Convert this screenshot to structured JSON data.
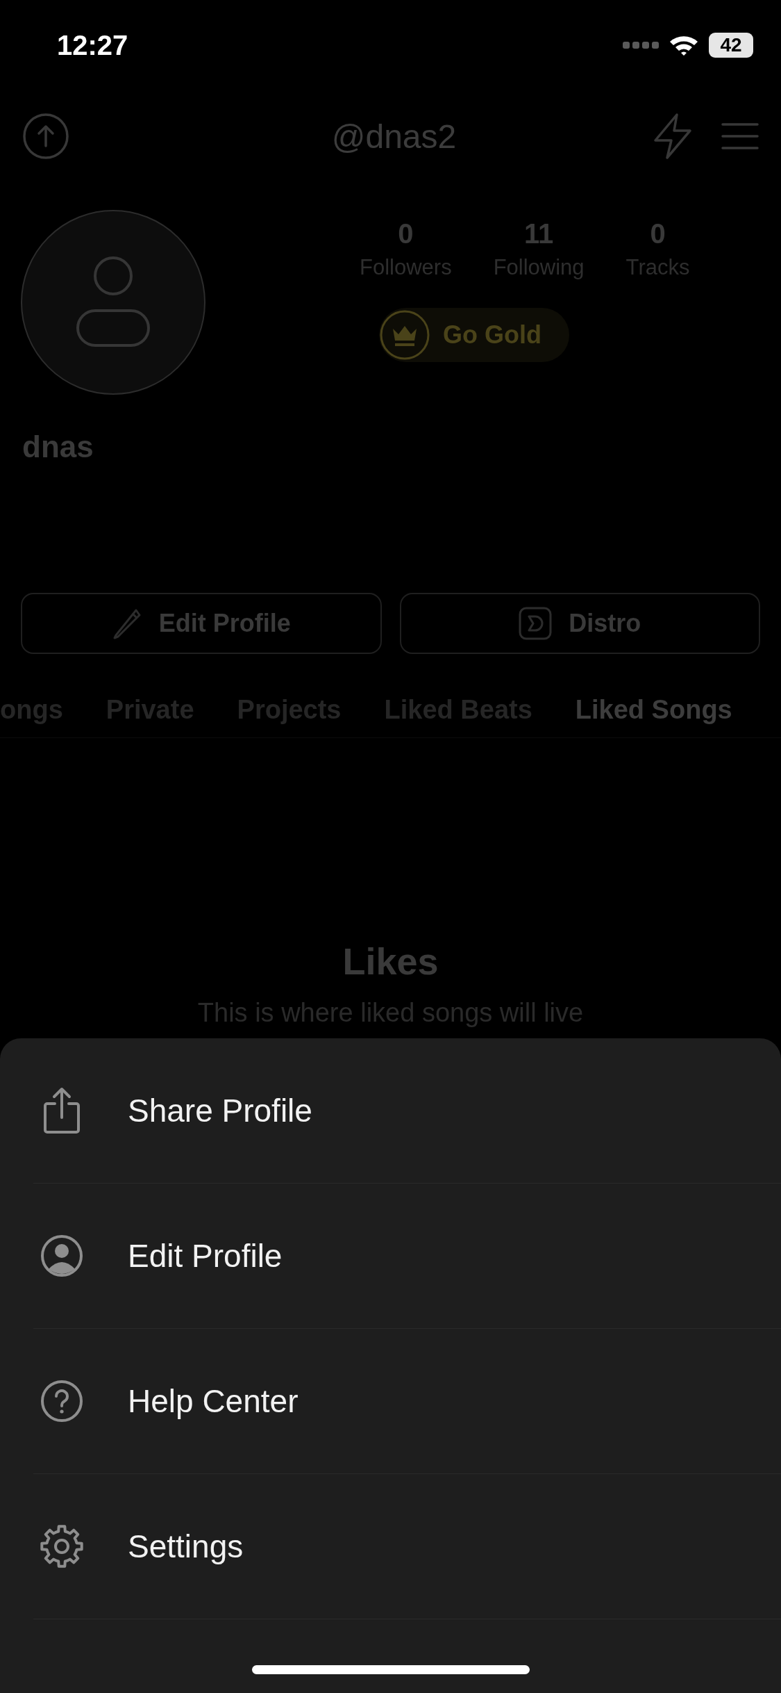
{
  "status_bar": {
    "time": "12:27",
    "battery": "42"
  },
  "header": {
    "title": "@dnas2"
  },
  "stats": [
    {
      "value": "0",
      "label": "Followers"
    },
    {
      "value": "11",
      "label": "Following"
    },
    {
      "value": "0",
      "label": "Tracks"
    }
  ],
  "gold_button": {
    "label": "Go Gold"
  },
  "display_name": "dnas",
  "actions": [
    {
      "label": "Edit Profile",
      "kind": "edit"
    },
    {
      "label": "Distro",
      "kind": "distro"
    }
  ],
  "tabs": [
    {
      "label": "ongs",
      "selected": false
    },
    {
      "label": "Private",
      "selected": false
    },
    {
      "label": "Projects",
      "selected": false
    },
    {
      "label": "Liked Beats",
      "selected": false
    },
    {
      "label": "Liked Songs",
      "selected": true
    }
  ],
  "empty_state": {
    "title": "Likes",
    "message": "This is where liked songs will live"
  },
  "menu": [
    {
      "label": "Share Profile",
      "kind": "share"
    },
    {
      "label": "Edit Profile",
      "kind": "person"
    },
    {
      "label": "Help Center",
      "kind": "help"
    },
    {
      "label": "Settings",
      "kind": "gear"
    }
  ]
}
